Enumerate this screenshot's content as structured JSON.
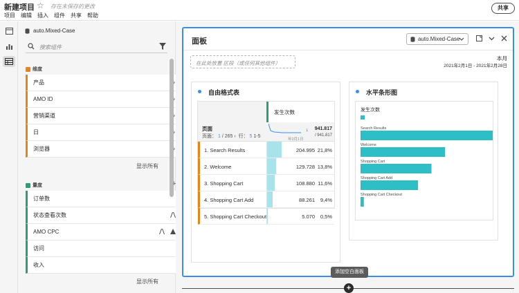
{
  "app": {
    "title": "新建项目",
    "unsaved": "存在未保存的更改",
    "menu": [
      "项目",
      "编辑",
      "插入",
      "组件",
      "共享",
      "帮助"
    ],
    "share_label": "共享"
  },
  "components": {
    "datasource": "auto.Mixed-Case",
    "search_placeholder": "搜索组件",
    "dimensions_label": "维度",
    "dimensions": [
      "产品",
      "AMO ID",
      "营销渠道",
      "日",
      "浏览器"
    ],
    "dimensions_show_all": "显示所有",
    "metrics_label": "量度",
    "metrics": [
      "订单数",
      "状态查看次数",
      "AMO CPC",
      "访问",
      "收入"
    ],
    "metrics_show_all": "显示所有"
  },
  "panel": {
    "title": "面板",
    "datasource": "auto.Mixed-Case",
    "drop_zone": "在此处放置 区段（或任何其他组件）",
    "date_label": "本月",
    "date_range": "2021年2月1日 - 2021年2月28日",
    "add_tooltip": "添加空白面板"
  },
  "freeform": {
    "title": "自由格式表",
    "metric": "发生次数",
    "dimension": "页面",
    "pager_prefix": "页面：",
    "page": "1",
    "page_total": "/ 265",
    "rows_label": "行：",
    "rows": "5",
    "range": "1-5",
    "sort_arrow": "↓",
    "total": "941.817",
    "total_sub": "/ 941.817",
    "spark_date": "年2月1日",
    "rows_data": [
      {
        "label": "1. Search Results",
        "value": "204.995",
        "pct": "21,8%",
        "fraction": 0.218
      },
      {
        "label": "2. Welcome",
        "value": "129.728",
        "pct": "13,8%",
        "fraction": 0.138
      },
      {
        "label": "3. Shopping Cart",
        "value": "108.880",
        "pct": "11,6%",
        "fraction": 0.116
      },
      {
        "label": "4. Shopping Cart Add",
        "value": "88.261",
        "pct": "9,4%",
        "fraction": 0.094
      },
      {
        "label": "5. Shopping Cart Checkout",
        "value": "5.070",
        "pct": "0,5%",
        "fraction": 0.005
      }
    ]
  },
  "chart_data": {
    "type": "bar",
    "orientation": "horizontal",
    "title": "水平条形图",
    "categories": [
      "Search Results",
      "Welcome",
      "Shopping Cart",
      "Shopping Cart Add",
      "Shopping Cart Checkout"
    ],
    "series": [
      {
        "name": "发生次数",
        "values": [
          204995,
          129728,
          108880,
          88261,
          5070
        ]
      }
    ],
    "color": "#2ebfc6",
    "legend": "top-left",
    "grid": false
  },
  "colors": {
    "accent": "#378ef0",
    "dimension": "#e68619",
    "metric": "#2d9d78",
    "bar": "#2ebfc6"
  }
}
